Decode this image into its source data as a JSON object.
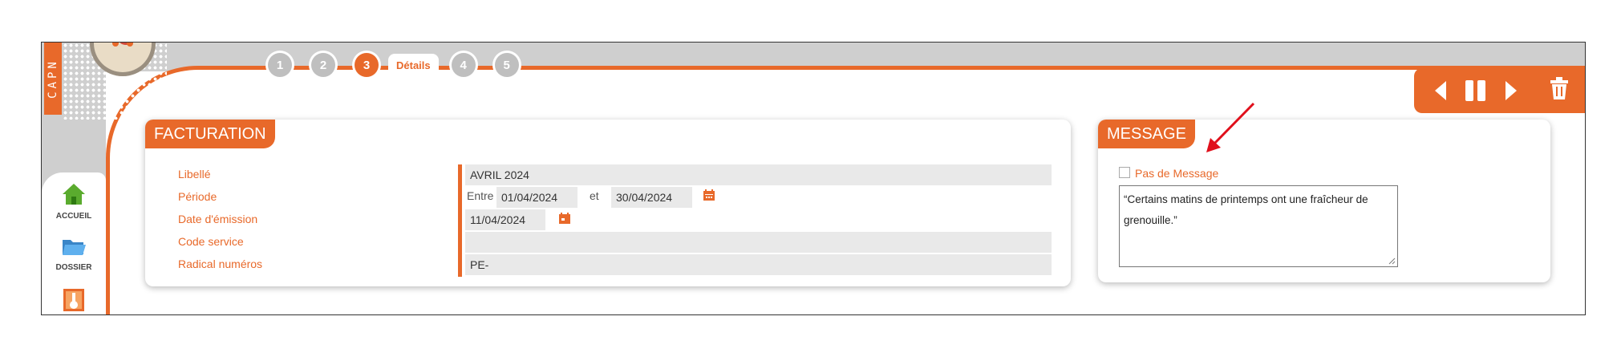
{
  "brand": {
    "logo_text": "CAPN"
  },
  "nav": [
    {
      "label": "ACCUEIL",
      "icon": "home-icon"
    },
    {
      "label": "DOSSIER",
      "icon": "folder-icon"
    },
    {
      "label": "",
      "icon": "touch-hand-icon"
    }
  ],
  "steps": [
    {
      "label": "1",
      "active": false
    },
    {
      "label": "2",
      "active": false
    },
    {
      "label": "3",
      "active": true
    },
    {
      "label": "4",
      "active": false
    },
    {
      "label": "5",
      "active": false
    }
  ],
  "active_step_tab": "Détails",
  "toolbar": {
    "icons": [
      "prev-icon",
      "pause-icon",
      "next-icon",
      "trash-icon"
    ]
  },
  "facturation": {
    "title": "FACTURATION",
    "labels": {
      "libelle": "Libellé",
      "periode": "Période",
      "date_emission": "Date d'émission",
      "code_service": "Code service",
      "radical": "Radical numéros"
    },
    "values": {
      "libelle": "AVRIL 2024",
      "periode_prefix": "Entre",
      "periode_start": "01/04/2024",
      "periode_sep": "et",
      "periode_end": "30/04/2024",
      "date_emission": "11/04/2024",
      "code_service": "",
      "radical": "PE-"
    }
  },
  "message": {
    "title": "MESSAGE",
    "checkbox_label": "Pas de Message",
    "checked": false,
    "text": "“Certains matins de printemps ont une fraîcheur de grenouille.”"
  },
  "colors": {
    "accent": "#e8692a",
    "panel_gray": "#cfcfcf",
    "field_bg": "#e9e9e9",
    "arrow": "#e0101c",
    "home_green": "#5aab2e",
    "folder_blue": "#4a98d8"
  }
}
